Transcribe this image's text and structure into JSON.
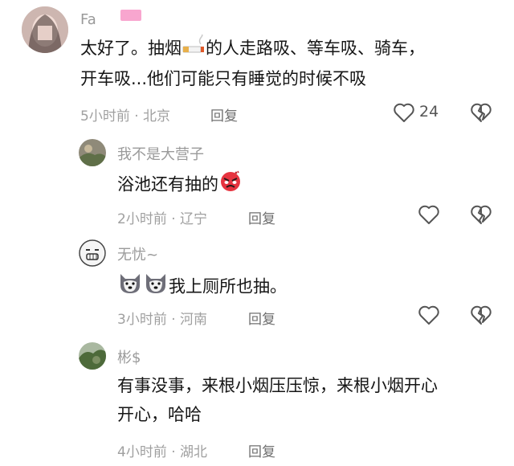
{
  "comments": [
    {
      "username": "Fa",
      "text_line1": "太好了。抽烟",
      "text_line1b": "的人走路吸、等车吸、骑车，",
      "text_line2": "开车吸...他们可能只有睡觉的时候不吸",
      "time": "5小时前",
      "location": "北京",
      "reply_label": "回复",
      "like_count": "24"
    },
    {
      "username": "我不是大营子",
      "text": "浴池还有抽的",
      "time": "2小时前",
      "location": "辽宁",
      "reply_label": "回复"
    },
    {
      "username": "无忧~",
      "text": "我上厕所也抽。",
      "time": "3小时前",
      "location": "河南",
      "reply_label": "回复"
    },
    {
      "username": "彬$",
      "text_line1": "有事没事，来根小烟压压惊，来根小烟开心",
      "text_line2": "开心，哈哈",
      "time": "4小时前",
      "location": "湖北",
      "reply_label": "回复"
    }
  ],
  "meta_separator": "·",
  "icons": {
    "like": "heart-outline-icon",
    "dislike": "broken-heart-icon",
    "cigarette": "cigarette-emoji",
    "angry": "angry-face-emoji",
    "husky": "husky-dog-emoji"
  },
  "colors": {
    "meta": "#a0a0a0",
    "reply": "#6f6f6f",
    "text": "#161616",
    "pink_mask": "#f8a6cf"
  }
}
